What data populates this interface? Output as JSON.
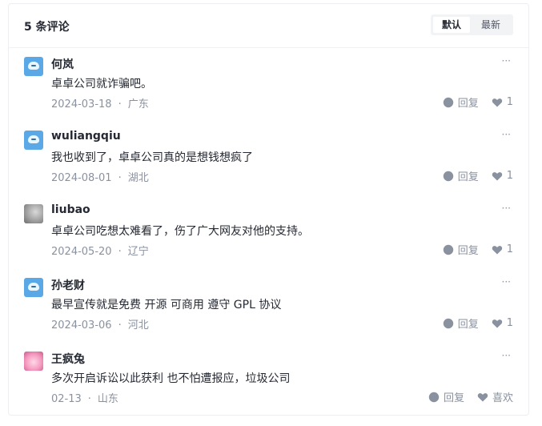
{
  "header": {
    "title": "5 条评论",
    "sort_default": "默认",
    "sort_new": "最新"
  },
  "comments": [
    {
      "user": "何岚",
      "text": "卓卓公司就诈骗吧。",
      "date": "2024-03-18",
      "location": "广东",
      "reply_label": "回复",
      "likes": "1",
      "avatar": "robot"
    },
    {
      "user": "wuliangqiu",
      "text": "我也收到了，卓卓公司真的是想钱想疯了",
      "date": "2024-08-01",
      "location": "湖北",
      "reply_label": "回复",
      "likes": "1",
      "avatar": "robot"
    },
    {
      "user": "liubao",
      "text": "卓卓公司吃想太难看了，伤了广大网友对他的支持。",
      "date": "2024-05-20",
      "location": "辽宁",
      "reply_label": "回复",
      "likes": "1",
      "avatar": "photo"
    },
    {
      "user": "孙老财",
      "text": "最早宣传就是免费 开源 可商用 遵守 GPL 协议",
      "date": "2024-03-06",
      "location": "河北",
      "reply_label": "回复",
      "likes": "1",
      "avatar": "robot"
    },
    {
      "user": "王疯兔",
      "text": "多次开启诉讼以此获利 也不怕遭报应，垃圾公司",
      "date": "02-13",
      "location": "山东",
      "reply_label": "回复",
      "likes": "喜欢",
      "avatar": "anime"
    }
  ],
  "separator": "·",
  "more_glyph": "···",
  "colors": {
    "muted": "#8a919f",
    "text": "#252933",
    "icon": "#8a919f"
  }
}
